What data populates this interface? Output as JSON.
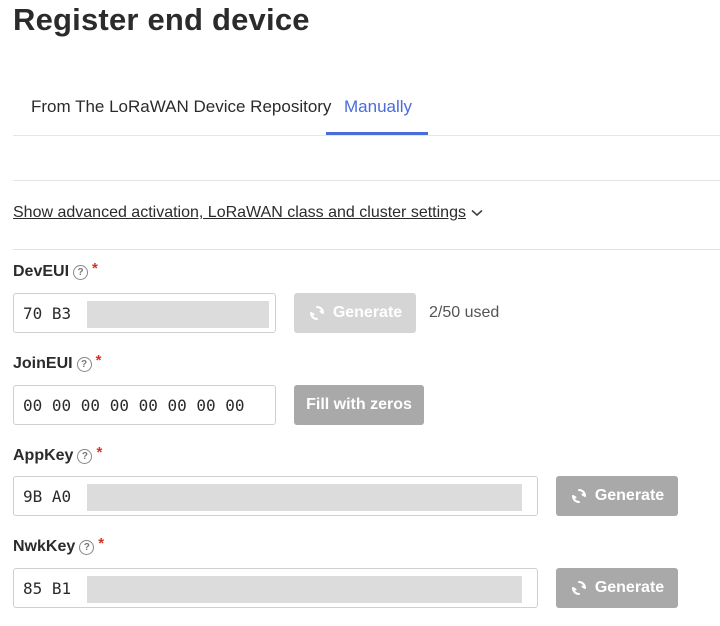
{
  "page": {
    "title": "Register end device"
  },
  "tabs": [
    {
      "label": "From The LoRaWAN Device Repository",
      "active": false
    },
    {
      "label": "Manually",
      "active": true
    }
  ],
  "advanced_link": {
    "label": "Show advanced activation, LoRaWAN class and cluster settings",
    "icon": "chevron-down-icon"
  },
  "fields": {
    "dev_eui": {
      "label": "DevEUI",
      "value": "70 B3",
      "button": "Generate",
      "usage": "2/50 used"
    },
    "join_eui": {
      "label": "JoinEUI",
      "value": "00 00 00 00 00 00 00 00",
      "button": "Fill with zeros"
    },
    "app_key": {
      "label": "AppKey",
      "value": "9B A0",
      "button": "Generate"
    },
    "nwk_key": {
      "label": "NwkKey",
      "value": "85 B1",
      "button": "Generate"
    }
  },
  "required_marker": "*",
  "help_glyph": "?",
  "colors": {
    "accent": "#4a6cd8",
    "required": "#d93025",
    "button": "#a9a9a9",
    "button_disabled": "#d5d5d5"
  }
}
